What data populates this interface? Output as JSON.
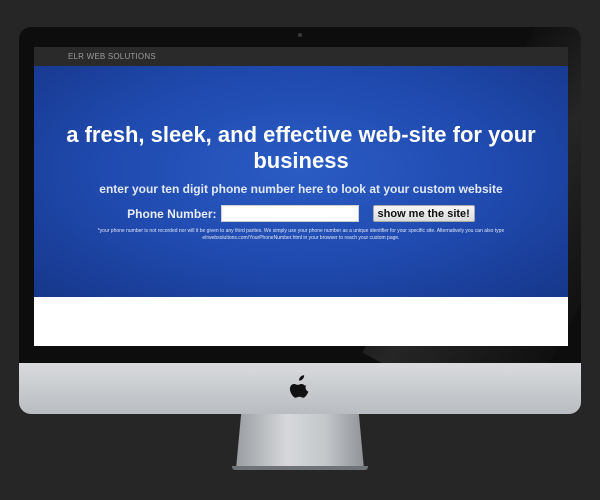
{
  "site": {
    "brand": "ELR WEB SOLUTIONS",
    "headline": "a fresh, sleek, and effective web-site for your business",
    "subheadline": "enter your ten digit phone number here to look at your custom website",
    "phone_label": "Phone Number:",
    "phone_value": "",
    "phone_placeholder": "",
    "button_label": "show me the site!",
    "disclaimer": "*your phone number is not recorded nor will it be given to any third parties. We simply use your phone number as a unique identifier for your specific site. Alternatively you can also type elrwebsolutions.com/YourPhoneNumber.html in your browser to reach your custom page."
  },
  "colors": {
    "background": "#262626",
    "hero_blue": "#1f49ad",
    "nav_bar": "#2a2a2a",
    "bezel": "#0d0d0d",
    "chin": "#cfd1d4"
  },
  "icons": {
    "logo": "apple-logo-icon"
  }
}
